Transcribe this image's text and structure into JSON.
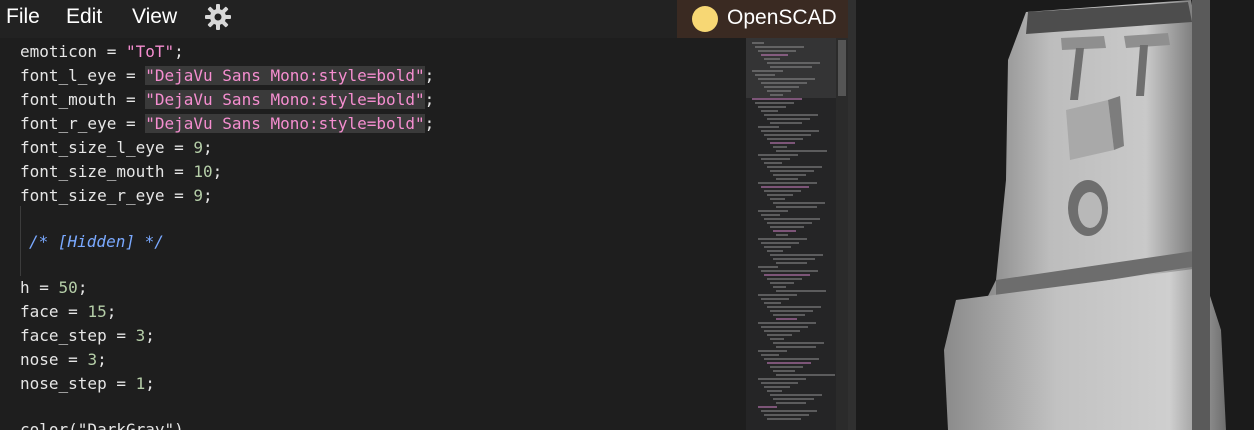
{
  "menubar": {
    "items": [
      "File",
      "Edit",
      "View"
    ],
    "settings_icon": "gear-icon",
    "app_name": "OpenSCAD",
    "app_icon": "sun-circle-icon"
  },
  "editor": {
    "lines": [
      {
        "key": "emoticon",
        "op": " = ",
        "value": "\"ToT\"",
        "end": ";"
      },
      {
        "key": "font_l_eye",
        "op": " = ",
        "value": "\"DejaVu Sans Mono:style=bold\"",
        "end": ";"
      },
      {
        "key": "font_mouth",
        "op": " = ",
        "value": "\"DejaVu Sans Mono:style=bold\"",
        "end": ";"
      },
      {
        "key": "font_r_eye",
        "op": " = ",
        "value": "\"DejaVu Sans Mono:style=bold\"",
        "end": ";"
      },
      {
        "key": "font_size_l_eye",
        "op": " = ",
        "value": "9",
        "end": ";"
      },
      {
        "key": "font_size_mouth",
        "op": " = ",
        "value": "10",
        "end": ";"
      },
      {
        "key": "font_size_r_eye",
        "op": " = ",
        "value": "9",
        "end": ";"
      },
      {
        "comment": "/* [Hidden] */"
      },
      {
        "key": "h",
        "op": " = ",
        "value": "50",
        "end": ";"
      },
      {
        "key": "face",
        "op": " = ",
        "value": "15",
        "end": ";"
      },
      {
        "key": "face_step",
        "op": " = ",
        "value": "3",
        "end": ";"
      },
      {
        "key": "nose",
        "op": " = ",
        "value": "3",
        "end": ";"
      },
      {
        "key": "nose_step",
        "op": " = ",
        "value": "1",
        "end": ";"
      },
      {
        "partial": "color(\"DarkGray\")"
      }
    ]
  },
  "colors": {
    "string": "#f58ed0",
    "comment": "#7aa9ff",
    "number": "#b5cea8",
    "brand_bg": "#3a2a22",
    "sun": "#f7d774"
  }
}
